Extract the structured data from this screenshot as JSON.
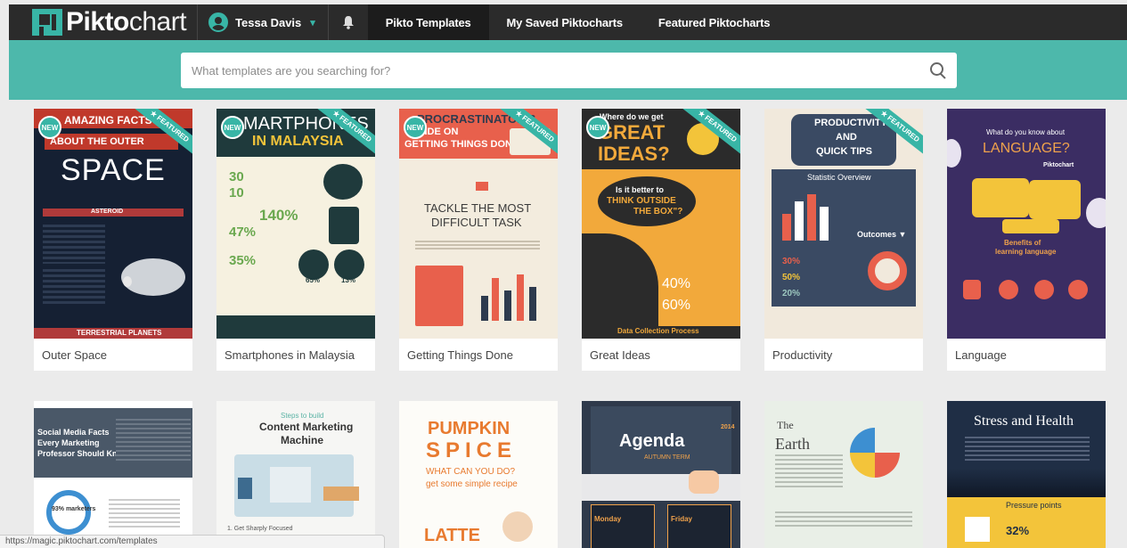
{
  "nav": {
    "logo_bold": "Pikto",
    "logo_thin": "chart",
    "user_name": "Tessa Davis",
    "tabs": [
      {
        "label": "Pikto Templates",
        "active": true
      },
      {
        "label": "My Saved Piktocharts",
        "active": false
      },
      {
        "label": "Featured Piktocharts",
        "active": false
      }
    ]
  },
  "search": {
    "placeholder": "What templates are you searching for?",
    "value": ""
  },
  "row1": [
    {
      "title": "Outer Space",
      "new": true,
      "featured": true,
      "content": {
        "h1": "AMAZING FACTS",
        "h2": "ABOUT THE OUTER",
        "h3": "SPACE",
        "h4": "ASTEROID",
        "footer": "TERRESTRIAL PLANETS"
      }
    },
    {
      "title": "Smartphones in Malaysia",
      "new": true,
      "featured": true,
      "content": {
        "h1": "MARTPHONES",
        "h2": "IN MALAYSIA",
        "s1": "30",
        "s2": "10",
        "s3": "140%",
        "s4": "47%",
        "s5": "35%",
        "s6": "65%",
        "s7": "13%"
      }
    },
    {
      "title": "Getting Things Done",
      "new": true,
      "featured": true,
      "content": {
        "h1": "PROCRASTINATOR'S",
        "h2": "GUIDE ON",
        "h3": "GETTING THINGS DONE",
        "h4": "TACKLE THE MOST",
        "h5": "DIFFICULT TASK"
      }
    },
    {
      "title": "Great Ideas",
      "new": true,
      "featured": true,
      "content": {
        "h1": "Where do we get",
        "h2": "GREAT",
        "h3": "IDEAS?",
        "h4": "Is it better to",
        "h5": "THINK OUTSIDE",
        "h6": "THE BOX\"?",
        "s1": "40%",
        "s2": "60%",
        "footer": "Data Collection Process"
      }
    },
    {
      "title": "Productivity",
      "new": false,
      "featured": true,
      "content": {
        "h1": "PRODUCTIVITY",
        "h2": "AND",
        "h3": "QUICK TIPS",
        "h4": "Statistic Overview",
        "h5": "Outcomes ▼",
        "s1": "30%",
        "s2": "50%",
        "s3": "20%"
      }
    },
    {
      "title": "Language",
      "new": false,
      "featured": false,
      "content": {
        "h1": "What do you know about",
        "h2": "LANGUAGE?",
        "h3": "Piktochart",
        "h4": "Benefits of",
        "h5": "learning language"
      }
    }
  ],
  "row2": [
    {
      "content": {
        "h1": "Social Media Facts",
        "h2": "Every Marketing",
        "h3": "Professor Should Know",
        "s1": "93% marketers"
      }
    },
    {
      "content": {
        "h1": "Steps to build",
        "h2": "Content Marketing",
        "h3": "Machine",
        "s1": "1. Get Sharply Focused"
      }
    },
    {
      "content": {
        "h1": "PUMPKIN",
        "h2": "SPICE",
        "h3": "WHAT CAN YOU DO?",
        "h4": "get some simple recipe",
        "h5": "LATTE"
      }
    },
    {
      "content": {
        "h1": "Agenda",
        "h2": "AUTUMN TERM",
        "h3": "2014",
        "h4": "Monday",
        "h5": "Friday"
      }
    },
    {
      "content": {
        "h1": "The",
        "h2": "Earth"
      }
    },
    {
      "content": {
        "h1": "Stress and Health",
        "h2": "Pressure points",
        "s1": "32%"
      }
    }
  ],
  "badges": {
    "new": "NEW",
    "featured": "★ FEATURED"
  },
  "status_url": "https://magic.piktochart.com/templates",
  "colors": {
    "accent": "#4db8ab",
    "nav_bg": "#2b2b2b"
  }
}
